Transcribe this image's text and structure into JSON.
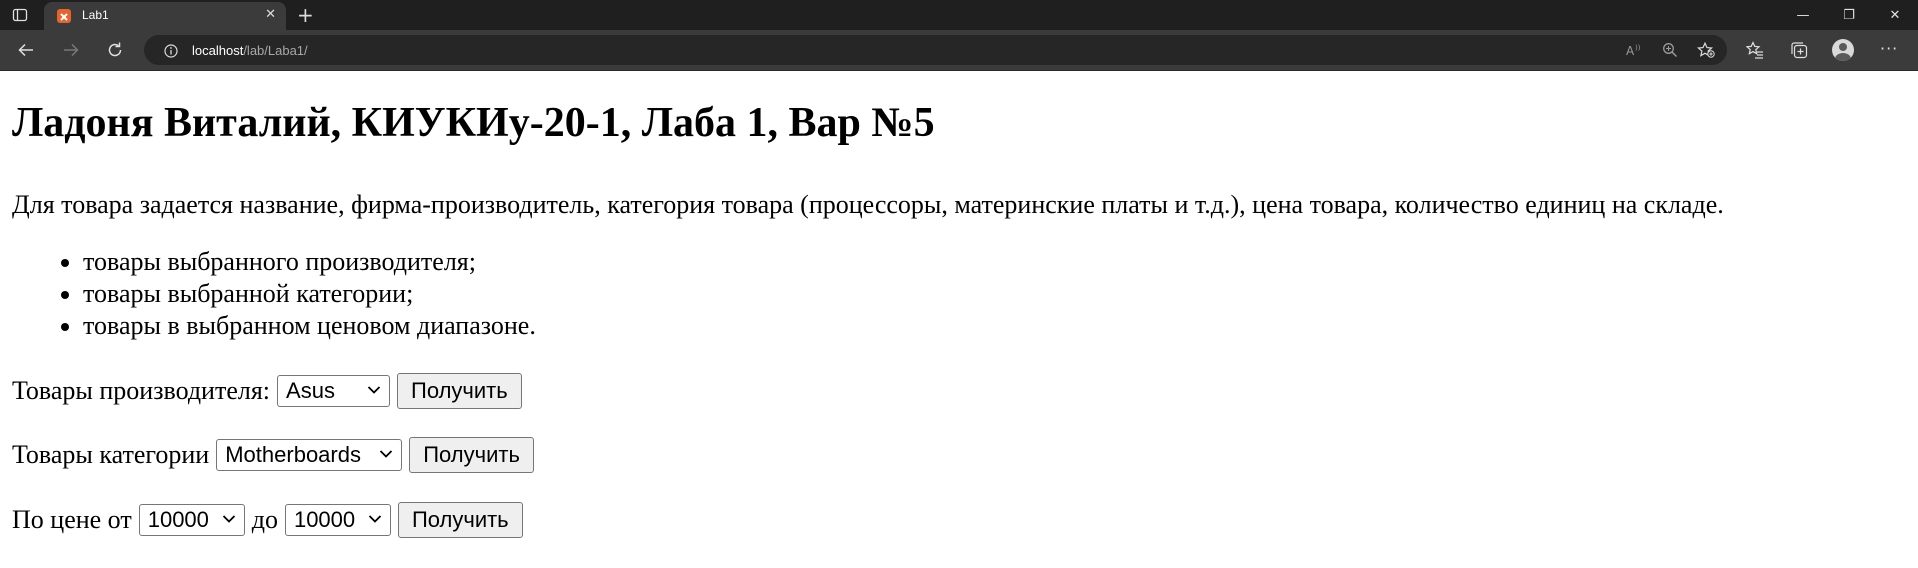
{
  "browser": {
    "tab": {
      "title": "Lab1",
      "close_glyph": "✕"
    },
    "new_tab_glyph": "+",
    "address": {
      "host": "localhost",
      "path": "/lab/Laba1/"
    },
    "window_controls": {
      "minimize": "—",
      "restore": "❐",
      "close": "✕"
    },
    "more_glyph": "···"
  },
  "page": {
    "title": "Ладоня Виталий, КИУКИу-20-1, Лаба 1, Вар №5",
    "description": "Для товара задается название, фирма-производитель, категория товара (процессоры, материнские платы и т.д.), цена товара, количество единиц на складе.",
    "tasks": [
      "товары выбранного производителя;",
      "товары выбранной категории;",
      "товары в выбранном ценовом диапазоне."
    ],
    "manufacturer_form": {
      "label": "Товары производителя:",
      "selected": "Asus",
      "button": "Получить"
    },
    "category_form": {
      "label": "Товары категории",
      "selected": "Motherboards",
      "button": "Получить"
    },
    "price_form": {
      "from_label": "По цене от",
      "from_value": "10000",
      "to_label": "до",
      "to_value": "10000",
      "button": "Получить"
    }
  },
  "icons": {
    "tab_actions": "tab-actions-icon",
    "favicon": "xampp-favicon",
    "back": "back-arrow-icon",
    "forward": "forward-arrow-icon",
    "refresh": "refresh-icon",
    "site_info": "info-icon",
    "read_aloud": "read-aloud-icon",
    "zoom": "zoom-icon",
    "favorite": "add-favorite-icon",
    "favorites": "favorites-icon",
    "collections": "collections-icon",
    "profile": "profile-avatar",
    "more": "more-icon"
  },
  "colors": {
    "tabbar_bg": "#1f1f1f",
    "toolbar_bg": "#3b3b3b",
    "address_bg": "#262626",
    "favicon": "#e8622c",
    "page_bg": "#ffffff"
  }
}
